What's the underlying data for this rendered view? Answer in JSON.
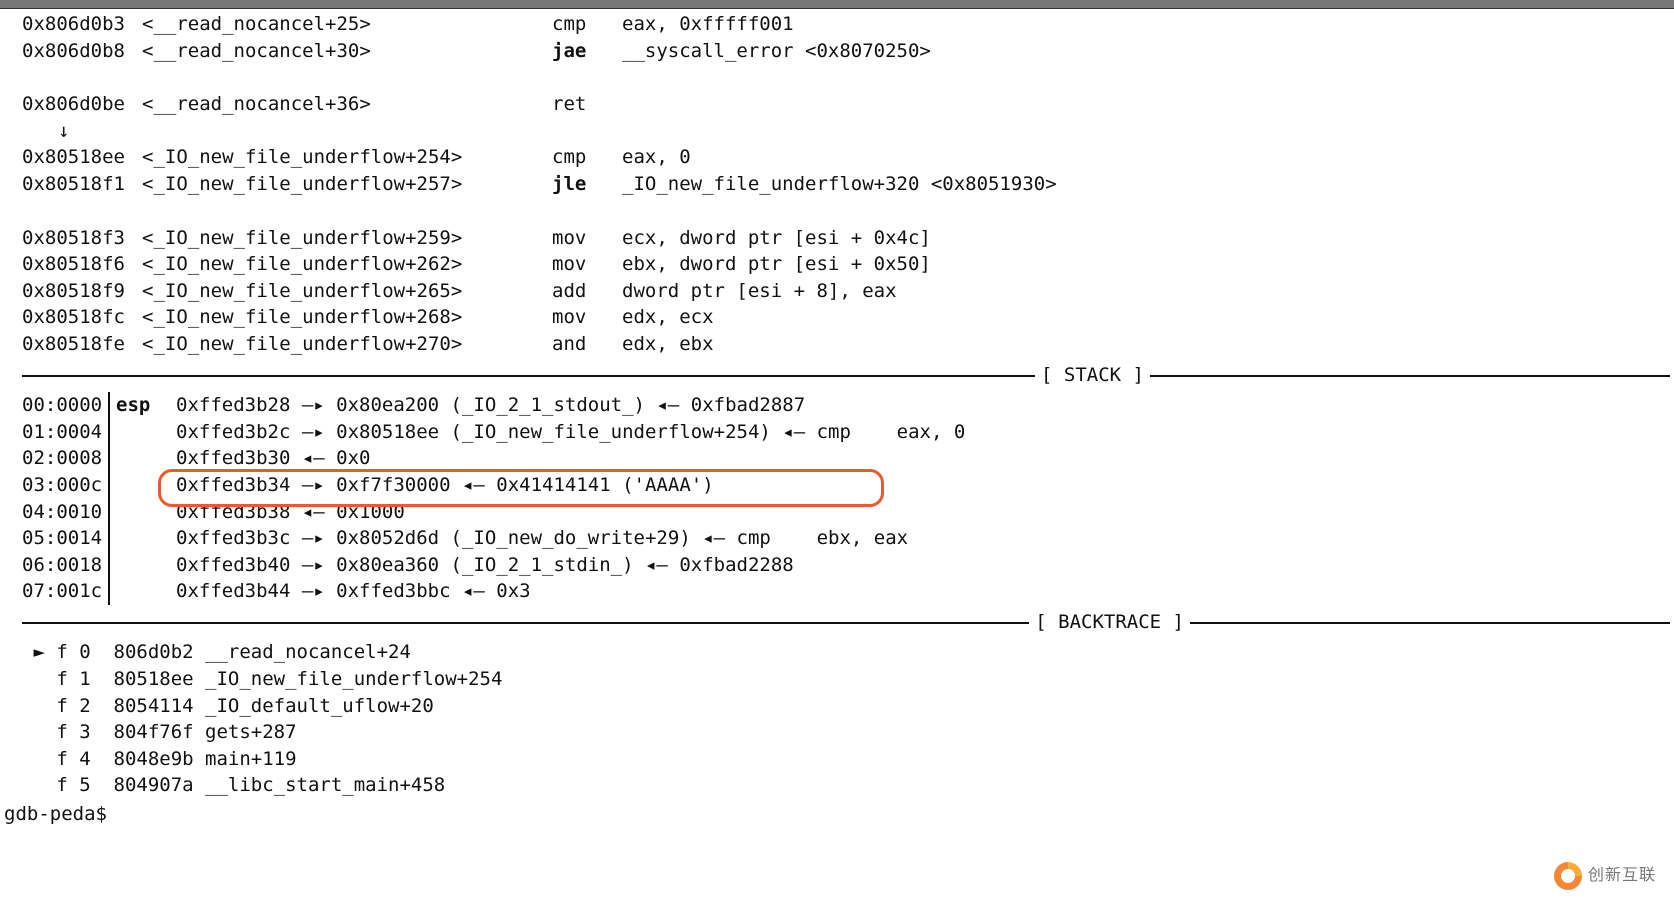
{
  "sections": {
    "stack": "STACK",
    "backtrace": "BACKTRACE"
  },
  "disasm": [
    {
      "addr": "0x806d0b3",
      "func": "<__read_nocancel+25>",
      "op": "cmp",
      "args": "eax, 0xfffff001"
    },
    {
      "addr": "0x806d0b8",
      "func": "<__read_nocancel+30>",
      "op": "jae",
      "args": "__syscall_error <0x8070250>",
      "bold": true
    },
    {
      "blank": true
    },
    {
      "addr": "0x806d0be",
      "func": "<__read_nocancel+36>",
      "op": "ret",
      "args": ""
    },
    {
      "arrow": "↓"
    },
    {
      "addr": "0x80518ee",
      "func": "<_IO_new_file_underflow+254>",
      "op": "cmp",
      "args": "eax, 0"
    },
    {
      "addr": "0x80518f1",
      "func": "<_IO_new_file_underflow+257>",
      "op": "jle",
      "args": "_IO_new_file_underflow+320 <0x8051930>",
      "bold": true
    },
    {
      "blank": true
    },
    {
      "addr": "0x80518f3",
      "func": "<_IO_new_file_underflow+259>",
      "op": "mov",
      "args": "ecx, dword ptr [esi + 0x4c]"
    },
    {
      "addr": "0x80518f6",
      "func": "<_IO_new_file_underflow+262>",
      "op": "mov",
      "args": "ebx, dword ptr [esi + 0x50]"
    },
    {
      "addr": "0x80518f9",
      "func": "<_IO_new_file_underflow+265>",
      "op": "add",
      "args": "dword ptr [esi + 8], eax"
    },
    {
      "addr": "0x80518fc",
      "func": "<_IO_new_file_underflow+268>",
      "op": "mov",
      "args": "edx, ecx"
    },
    {
      "addr": "0x80518fe",
      "func": "<_IO_new_file_underflow+270>",
      "op": "and",
      "args": "edx, ebx"
    }
  ],
  "stack": [
    {
      "idx": "00:0000",
      "reg": "esp",
      "body": "0xffed3b28 —▸ 0x80ea200 (_IO_2_1_stdout_) ◂— 0xfbad2887"
    },
    {
      "idx": "01:0004",
      "reg": "",
      "body": "0xffed3b2c —▸ 0x80518ee (_IO_new_file_underflow+254) ◂— cmp    eax, 0"
    },
    {
      "idx": "02:0008",
      "reg": "",
      "body": "0xffed3b30 ◂— 0x0"
    },
    {
      "idx": "03:000c",
      "reg": "",
      "body": "0xffed3b34 —▸ 0xf7f30000 ◂— 0x41414141 ('AAAA')",
      "hl": true
    },
    {
      "idx": "04:0010",
      "reg": "",
      "body": "0xffed3b38 ◂— 0x1000"
    },
    {
      "idx": "05:0014",
      "reg": "",
      "body": "0xffed3b3c —▸ 0x8052d6d (_IO_new_do_write+29) ◂— cmp    ebx, eax"
    },
    {
      "idx": "06:0018",
      "reg": "",
      "body": "0xffed3b40 —▸ 0x80ea360 (_IO_2_1_stdin_) ◂— 0xfbad2288"
    },
    {
      "idx": "07:001c",
      "reg": "",
      "body": "0xffed3b44 —▸ 0xffed3bbc ◂— 0x3"
    }
  ],
  "backtrace": [
    " ► f 0  806d0b2 __read_nocancel+24",
    "   f 1  80518ee _IO_new_file_underflow+254",
    "   f 2  8054114 _IO_default_uflow+20",
    "   f 3  804f76f gets+287",
    "   f 4  8048e9b main+119",
    "   f 5  804907a __libc_start_main+458"
  ],
  "prompt": "gdb-peda$ ",
  "watermark": "创新互联"
}
